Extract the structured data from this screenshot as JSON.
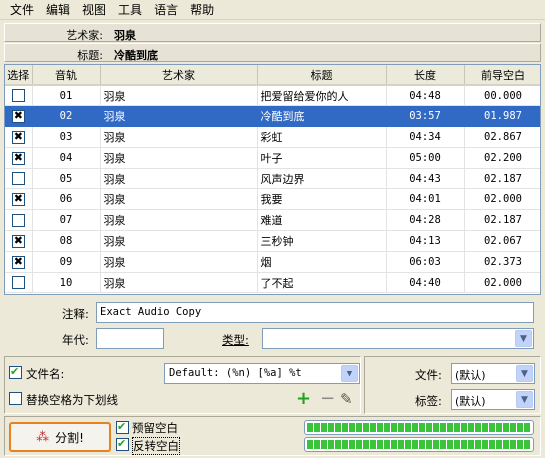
{
  "menu": [
    "文件",
    "编辑",
    "视图",
    "工具",
    "语言",
    "帮助"
  ],
  "info": {
    "artist_label": "艺术家:",
    "artist_value": "羽泉",
    "title_label": "标题:",
    "title_value": "冷酷到底"
  },
  "table": {
    "headers": [
      "选择",
      "音轨",
      "艺术家",
      "标题",
      "长度",
      "前导空白"
    ],
    "rows": [
      {
        "checked": false,
        "track": "01",
        "artist": "羽泉",
        "title": "把爱留给爱你的人",
        "length": "04:48",
        "gap": "00.000"
      },
      {
        "checked": true,
        "track": "02",
        "artist": "羽泉",
        "title": "冷酷到底",
        "length": "03:57",
        "gap": "01.987",
        "selected": true
      },
      {
        "checked": true,
        "track": "03",
        "artist": "羽泉",
        "title": "彩虹",
        "length": "04:34",
        "gap": "02.867"
      },
      {
        "checked": true,
        "track": "04",
        "artist": "羽泉",
        "title": "叶子",
        "length": "05:00",
        "gap": "02.200"
      },
      {
        "checked": false,
        "track": "05",
        "artist": "羽泉",
        "title": "风声边界",
        "length": "04:43",
        "gap": "02.187"
      },
      {
        "checked": true,
        "track": "06",
        "artist": "羽泉",
        "title": "我要",
        "length": "04:01",
        "gap": "02.000"
      },
      {
        "checked": false,
        "track": "07",
        "artist": "羽泉",
        "title": "难道",
        "length": "04:28",
        "gap": "02.187"
      },
      {
        "checked": true,
        "track": "08",
        "artist": "羽泉",
        "title": "三秒钟",
        "length": "04:13",
        "gap": "02.067"
      },
      {
        "checked": true,
        "track": "09",
        "artist": "羽泉",
        "title": "烟",
        "length": "06:03",
        "gap": "02.373"
      },
      {
        "checked": false,
        "track": "10",
        "artist": "羽泉",
        "title": "了不起",
        "length": "04:40",
        "gap": "02.000"
      }
    ]
  },
  "form": {
    "comment_label": "注释:",
    "comment_value": "Exact Audio Copy",
    "year_label": "年代:",
    "year_value": "",
    "genre_label": "类型:",
    "genre_value": ""
  },
  "options": {
    "filename_label": "文件名:",
    "filename_checked": true,
    "filename_pattern": "Default: (%n) [%a] %t",
    "underscore_label": "替换空格为下划线",
    "underscore_checked": false,
    "file_label": "文件:",
    "file_value": "(默认)",
    "tag_label": "标签:",
    "tag_value": "(默认)"
  },
  "bottom": {
    "split_label": "分割!",
    "keep_gap_label": "预留空白",
    "keep_gap_checked": true,
    "reverse_gap_label": "反转空白",
    "reverse_gap_checked": true,
    "progress1": 1.0,
    "progress2": 1.0
  },
  "colors": {
    "selection": "#316ac5",
    "progress": "#3bc43b",
    "accent": "#e8821e"
  }
}
